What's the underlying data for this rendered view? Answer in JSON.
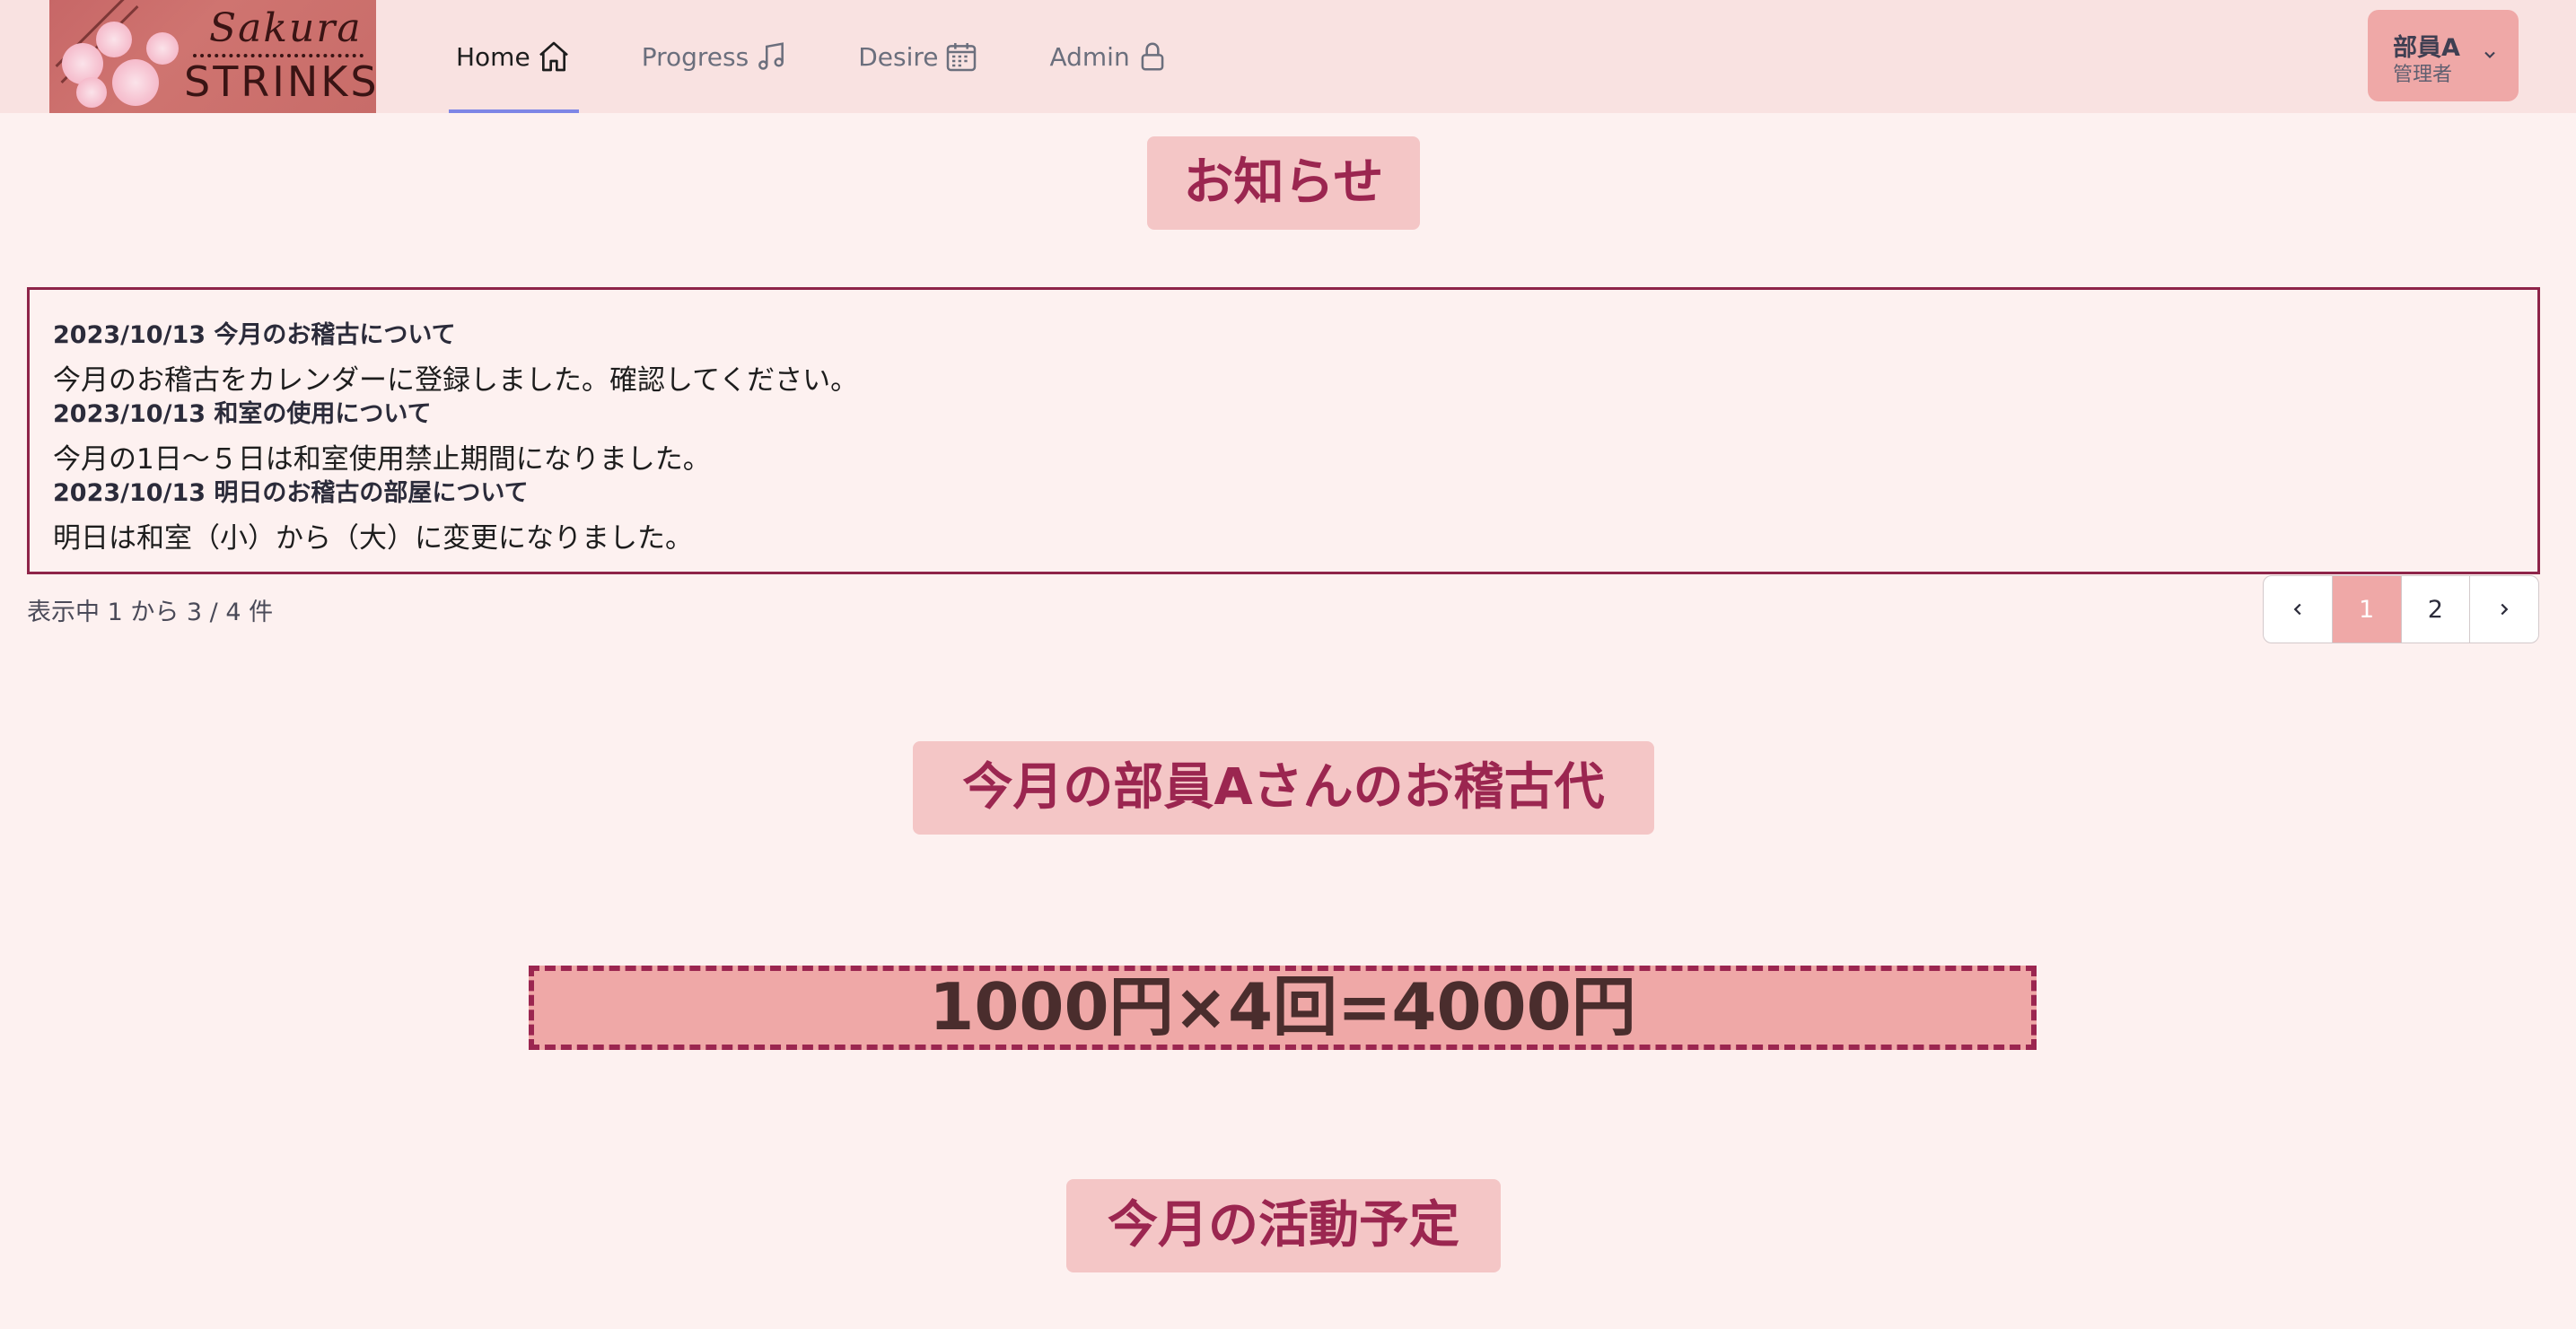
{
  "logo": {
    "line1": "Sakura",
    "line2": "STRINKS"
  },
  "nav": {
    "items": [
      {
        "label": "Home",
        "icon": "home-icon"
      },
      {
        "label": "Progress",
        "icon": "music-note-icon"
      },
      {
        "label": "Desire",
        "icon": "calendar-icon"
      },
      {
        "label": "Admin",
        "icon": "lock-icon"
      }
    ],
    "active": "Home"
  },
  "user": {
    "name": "部員A",
    "role": "管理者"
  },
  "news": {
    "title": "お知らせ",
    "items": [
      {
        "head": "2023/10/13 今月のお稽古について",
        "body": "今月のお稽古をカレンダーに登録しました。確認してください。"
      },
      {
        "head": "2023/10/13 和室の使用について",
        "body": "今月の1日～５日は和室使用禁止期間になりました。"
      },
      {
        "head": "2023/10/13 明日のお稽古の部屋について",
        "body": "明日は和室（小）から（大）に変更になりました。"
      }
    ],
    "count_text": "表示中 1 から 3 / 4 件",
    "pagination": {
      "prev": "‹",
      "pages": [
        "1",
        "2"
      ],
      "current": "1",
      "next": "›"
    }
  },
  "fee": {
    "title": "今月の部員Aさんのお稽古代",
    "formula": "1000円×4回=4000円"
  },
  "schedule": {
    "title": "今月の活動予定"
  },
  "colors": {
    "accent": "#9b2650",
    "header_bg": "#f9e2e1",
    "page_bg": "#fdf1f0",
    "title_bg": "#f4c6c6",
    "pink": "#efa8a7",
    "tab_underline": "#7e86e6"
  }
}
